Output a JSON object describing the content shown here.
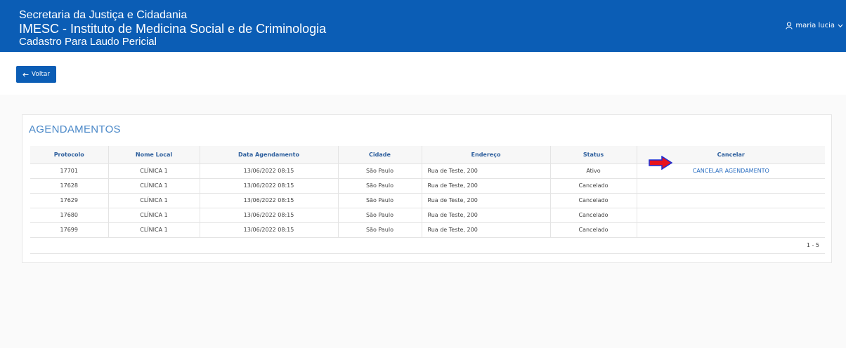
{
  "header": {
    "line1": "Secretaria da Justiça e Cidadania",
    "line2": "IMESC - Instituto de Medicina Social e de Criminologia",
    "line3": "Cadastro Para Laudo Pericial",
    "user_name": "maria lucia",
    "user_icon": "user-icon",
    "chevron_icon": "chevron-down-icon"
  },
  "back_button": {
    "label": "Voltar",
    "icon": "arrow-left-icon"
  },
  "section": {
    "title": "AGENDAMENTOS",
    "columns": [
      "Protocolo",
      "Nome Local",
      "Data Agendamento",
      "Cidade",
      "Endereço",
      "Status",
      "Cancelar"
    ],
    "rows": [
      {
        "protocolo": "17701",
        "local": "CLÍNICA 1",
        "data": "13/06/2022 08:15",
        "cidade": "São Paulo",
        "endereco": "Rua de Teste, 200",
        "status": "Ativo",
        "cancelar": "CANCELAR AGENDAMENTO"
      },
      {
        "protocolo": "17628",
        "local": "CLÍNICA 1",
        "data": "13/06/2022 08:15",
        "cidade": "São Paulo",
        "endereco": "Rua de Teste, 200",
        "status": "Cancelado",
        "cancelar": ""
      },
      {
        "protocolo": "17629",
        "local": "CLÍNICA 1",
        "data": "13/06/2022 08:15",
        "cidade": "São Paulo",
        "endereco": "Rua de Teste, 200",
        "status": "Cancelado",
        "cancelar": ""
      },
      {
        "protocolo": "17680",
        "local": "CLÍNICA 1",
        "data": "13/06/2022 08:15",
        "cidade": "São Paulo",
        "endereco": "Rua de Teste, 200",
        "status": "Cancelado",
        "cancelar": ""
      },
      {
        "protocolo": "17699",
        "local": "CLÍNICA 1",
        "data": "13/06/2022 08:15",
        "cidade": "São Paulo",
        "endereco": "Rua de Teste, 200",
        "status": "Cancelado",
        "cancelar": ""
      }
    ],
    "pagination": "1 - 5"
  },
  "annotation": {
    "icon": "red-arrow-icon"
  },
  "colors": {
    "primary": "#0b5db5",
    "title": "#4a88c8",
    "header_text": "#2b5d9c",
    "link": "#2b6fc2",
    "arrow_fill": "#e8141c",
    "arrow_stroke": "#1a2fd6"
  }
}
